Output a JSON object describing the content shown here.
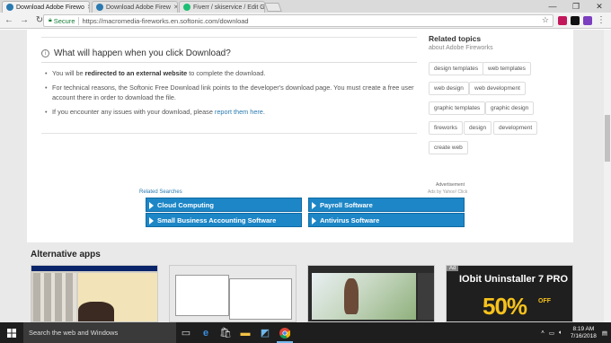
{
  "browser": {
    "tabs": [
      {
        "title": "Download Adobe Firewo",
        "favicon_color": "#2a7ab0",
        "active": true
      },
      {
        "title": "Download Adobe Firew",
        "favicon_color": "#2a7ab0",
        "active": false
      },
      {
        "title": "Fiverr / skiservice / Edit G",
        "favicon_color": "#1dbf73",
        "active": false
      }
    ],
    "secure_label": "Secure",
    "url": "https://macromedia-fireworks.en.softonic.com/download"
  },
  "page": {
    "what_happens_title": "What will happen when you click Download?",
    "bullets": [
      {
        "pre": "You will be ",
        "bold": "redirected to an external website",
        "post": " to complete the download."
      },
      {
        "text": "For technical reasons, the Softonic Free Download link points to the developer's download page. You must create a free user account there in order to download the file."
      },
      {
        "pre": "If you encounter any issues with your download, please ",
        "link": "report them here",
        "post": "."
      }
    ],
    "related_topics": {
      "title": "Related topics",
      "subtitle": "about Adobe Fireworks",
      "chips": [
        "design templates",
        "web templates",
        "web design",
        "web development",
        "graphic templates",
        "graphic design",
        "fireworks",
        "design",
        "development",
        "create web"
      ]
    },
    "ad": {
      "label": "Advertisement",
      "related_searches": "Related Searches",
      "adchoices": "Ads by Yahoo! Click",
      "buttons": [
        "Cloud Computing",
        "Payroll Software",
        "Small Business Accounting Software",
        "Antivirus Software"
      ]
    },
    "alternative_apps": {
      "title": "Alternative apps",
      "iobit": {
        "badge": "Ad",
        "title": "IObit Uninstaller 7 PRO",
        "discount": "50%",
        "off": "OFF"
      }
    }
  },
  "taskbar": {
    "search_placeholder": "Search the web and Windows",
    "time": "8:19 AM",
    "date": "7/16/2018"
  }
}
